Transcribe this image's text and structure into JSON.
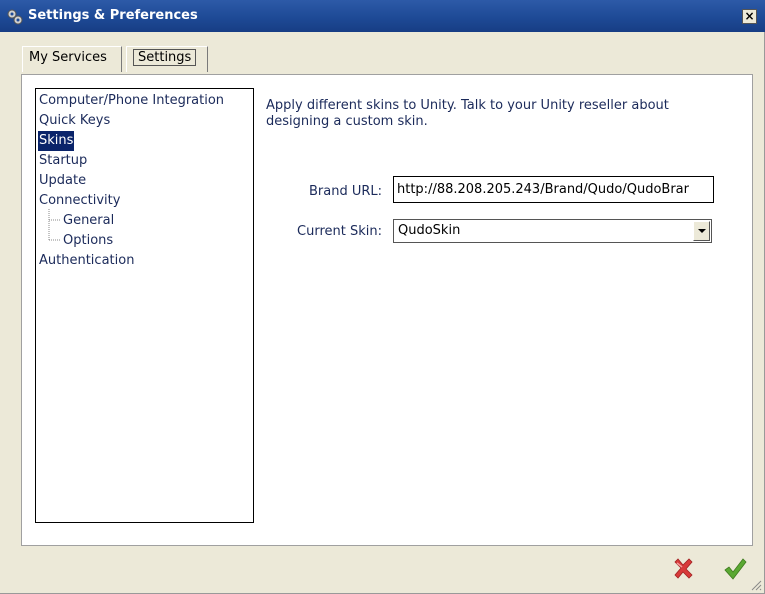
{
  "window": {
    "title": "Settings & Preferences",
    "close_label": "×"
  },
  "tabs": [
    {
      "label": "My Services",
      "selected": false
    },
    {
      "label": "Settings",
      "selected": true
    }
  ],
  "tree": {
    "items": [
      {
        "label": "Computer/Phone Integration"
      },
      {
        "label": "Quick Keys"
      },
      {
        "label": "Skins",
        "selected": true
      },
      {
        "label": "Startup"
      },
      {
        "label": "Update"
      },
      {
        "label": "Connectivity"
      },
      {
        "label": "General"
      },
      {
        "label": "Options"
      },
      {
        "label": "Authentication"
      }
    ]
  },
  "content": {
    "description": "Apply different skins to Unity.  Talk to your Unity reseller about designing a custom skin.",
    "brand_url_label": "Brand URL:",
    "brand_url_value": "http://88.208.205.243/Brand/Qudo/QudoBrar",
    "current_skin_label": "Current Skin:",
    "current_skin_value": "QudoSkin"
  },
  "icons": {
    "cancel": "cancel-x-icon",
    "ok": "ok-check-icon",
    "title": "gear-icon"
  },
  "colors": {
    "titlebar": "#1e4a96",
    "selection": "#0a246a",
    "cancel": "#d83a3a",
    "ok": "#5aa832"
  }
}
